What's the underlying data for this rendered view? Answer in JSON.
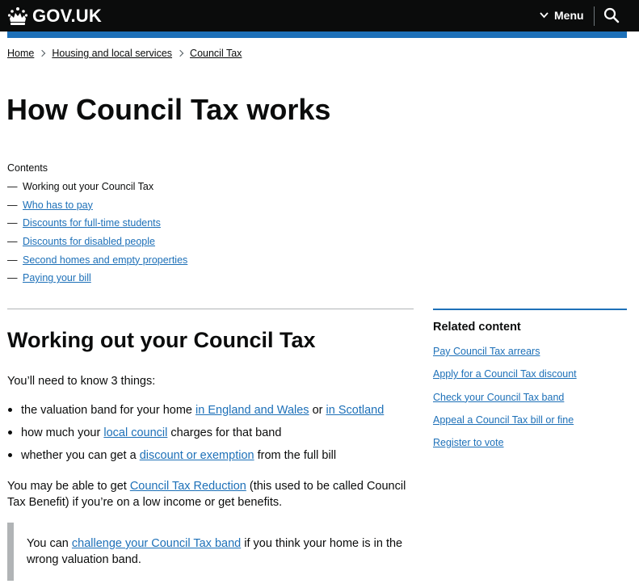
{
  "header": {
    "logo_text": "GOV.UK",
    "menu_label": "Menu"
  },
  "breadcrumbs": [
    "Home",
    "Housing and local services",
    "Council Tax"
  ],
  "page_title": "How Council Tax works",
  "contents": {
    "label": "Contents",
    "items": [
      {
        "label": "Working out your Council Tax",
        "current": true
      },
      {
        "label": "Who has to pay",
        "current": false
      },
      {
        "label": "Discounts for full-time students",
        "current": false
      },
      {
        "label": "Discounts for disabled people",
        "current": false
      },
      {
        "label": "Second homes and empty properties",
        "current": false
      },
      {
        "label": "Paying your bill",
        "current": false
      }
    ]
  },
  "main": {
    "section_title": "Working out your Council Tax",
    "intro": "You’ll need to know 3 things:",
    "bullet_1": {
      "pre": "the valuation band for your home ",
      "link_1": "in England and Wales",
      "mid": " or ",
      "link_2": "in Scotland"
    },
    "bullet_2": {
      "pre": "how much your ",
      "link": "local council",
      "post": " charges for that band"
    },
    "bullet_3": {
      "pre": "whether you can get a ",
      "link": "discount or exemption",
      "post": " from the full bill"
    },
    "reduction": {
      "pre": "You may be able to get ",
      "link": "Council Tax Reduction",
      "post": " (this used to be called Council Tax Benefit) if you’re on a low income or get benefits."
    },
    "inset": {
      "pre": "You can ",
      "link": "challenge your Council Tax band",
      "post": " if you think your home is in the wrong valuation band."
    }
  },
  "related": {
    "title": "Related content",
    "items": [
      "Pay Council Tax arrears",
      "Apply for a Council Tax discount",
      "Check your Council Tax band",
      "Appeal a Council Tax bill or fine",
      "Register to vote"
    ]
  },
  "colors": {
    "header_bg": "#0b0c0c",
    "brand_blue": "#1d70b8",
    "link": "#1d70b8",
    "text": "#0b0c0c",
    "border_grey": "#b1b4b6"
  }
}
